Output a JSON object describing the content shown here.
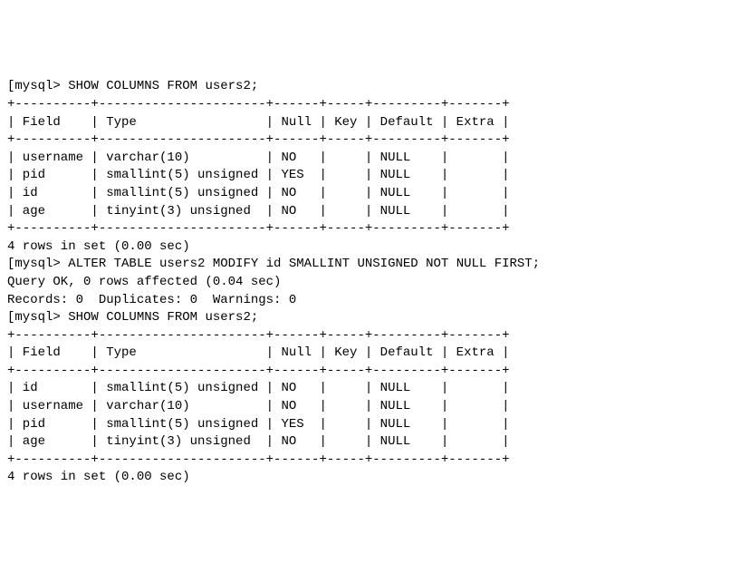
{
  "prompt": "mysql>",
  "bracket": "[",
  "commands": {
    "show1": "SHOW COLUMNS FROM users2;",
    "alter": "ALTER TABLE users2 MODIFY id SMALLINT UNSIGNED NOT NULL FIRST;",
    "show2": "SHOW COLUMNS FROM users2;"
  },
  "headers": {
    "field": "Field",
    "type": "Type",
    "null": "Null",
    "key": "Key",
    "default": "Default",
    "extra": "Extra"
  },
  "table1": {
    "rows": [
      {
        "field": "username",
        "type": "varchar(10)",
        "null": "NO",
        "key": "",
        "default": "NULL",
        "extra": ""
      },
      {
        "field": "pid",
        "type": "smallint(5) unsigned",
        "null": "YES",
        "key": "",
        "default": "NULL",
        "extra": ""
      },
      {
        "field": "id",
        "type": "smallint(5) unsigned",
        "null": "NO",
        "key": "",
        "default": "NULL",
        "extra": ""
      },
      {
        "field": "age",
        "type": "tinyint(3) unsigned",
        "null": "NO",
        "key": "",
        "default": "NULL",
        "extra": ""
      }
    ],
    "footer": "4 rows in set (0.00 sec)"
  },
  "alter_result": {
    "line1": "Query OK, 0 rows affected (0.04 sec)",
    "line2": "Records: 0  Duplicates: 0  Warnings: 0"
  },
  "table2": {
    "rows": [
      {
        "field": "id",
        "type": "smallint(5) unsigned",
        "null": "NO",
        "key": "",
        "default": "NULL",
        "extra": ""
      },
      {
        "field": "username",
        "type": "varchar(10)",
        "null": "NO",
        "key": "",
        "default": "NULL",
        "extra": ""
      },
      {
        "field": "pid",
        "type": "smallint(5) unsigned",
        "null": "YES",
        "key": "",
        "default": "NULL",
        "extra": ""
      },
      {
        "field": "age",
        "type": "tinyint(3) unsigned",
        "null": "NO",
        "key": "",
        "default": "NULL",
        "extra": ""
      }
    ],
    "footer": "4 rows in set (0.00 sec)"
  },
  "widths": {
    "field": 10,
    "type": 22,
    "null": 6,
    "key": 5,
    "default": 9,
    "extra": 7
  }
}
